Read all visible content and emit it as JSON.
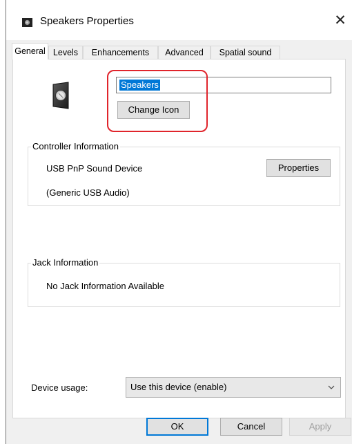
{
  "window": {
    "title": "Speakers Properties",
    "close_glyph": "✕"
  },
  "tabs": [
    {
      "label": "General",
      "active": true
    },
    {
      "label": "Levels",
      "active": false
    },
    {
      "label": "Enhancements",
      "active": false
    },
    {
      "label": "Advanced",
      "active": false
    },
    {
      "label": "Spatial sound",
      "active": false
    }
  ],
  "general": {
    "device_name": "Speakers",
    "change_icon_label": "Change Icon"
  },
  "controller": {
    "group_title": "Controller Information",
    "device": "USB PnP Sound Device",
    "driver": "(Generic USB Audio)",
    "properties_label": "Properties"
  },
  "jack": {
    "group_title": "Jack Information",
    "status": "No Jack Information Available"
  },
  "device_usage": {
    "label": "Device usage:",
    "selected": "Use this device (enable)"
  },
  "footer": {
    "ok_label": "OK",
    "cancel_label": "Cancel",
    "apply_label": "Apply"
  },
  "colors": {
    "accent": "#0078d7",
    "highlight": "#e0242b"
  }
}
